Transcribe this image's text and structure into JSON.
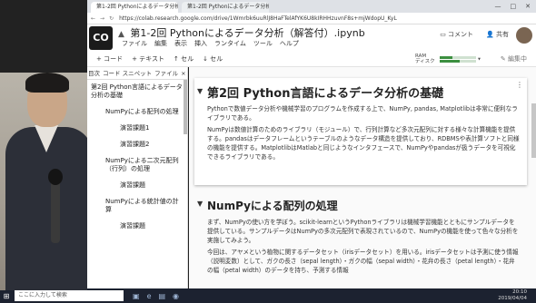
{
  "browser": {
    "tabs": [
      "第1-2回 Pythonによるデータ分析",
      "第1-2回 Pythonによるデータ分析"
    ],
    "url": "https://colab.research.google.com/drive/1Wmrbk6uuRlJ8HaFTelAfYK6U8kIRHHzuvnF8s+mjWdopU_KyL",
    "window_controls": [
      "—",
      "□",
      "✕"
    ]
  },
  "colab": {
    "logo": "CO",
    "title": "第1-2回 Pythonによるデータ分析（解答付）.ipynb",
    "menu": [
      "ファイル",
      "編集",
      "表示",
      "挿入",
      "ランタイム",
      "ツール",
      "ヘルプ"
    ],
    "comment_label": "コメント",
    "share_label": "共有"
  },
  "toolbar": {
    "code_label": "+ コード",
    "text_label": "+ テキスト",
    "cell_up": "↑ セル",
    "cell_down": "↓ セル",
    "ram_label": "RAM",
    "disk_label": "ディスク",
    "ram_fill": 0.35,
    "disk_fill": 0.55,
    "edit_label": "編集中"
  },
  "sidebar": {
    "tabs": [
      "目次",
      "コード スニペット",
      "ファイル"
    ],
    "close": "×",
    "toc": [
      {
        "level": 1,
        "label": "第2回 Python言語によるデータ分析の基礎"
      },
      {
        "level": 2,
        "label": "NumPyによる配列の処理"
      },
      {
        "level": 3,
        "label": "演習課題1"
      },
      {
        "level": 3,
        "label": "演習課題2"
      },
      {
        "level": 2,
        "label": "NumPyによる二次元配列（行列）の処理"
      },
      {
        "level": 3,
        "label": "演習課題"
      },
      {
        "level": 2,
        "label": "NumPyによる統計値の計算"
      },
      {
        "level": 3,
        "label": "演習課題"
      }
    ]
  },
  "content": {
    "section1": {
      "heading": "第2回 Python言語によるデータ分析の基礎",
      "paras": [
        "Pythonで数値データ分析や機械学習のプログラムを作成する上で、NumPy, pandas, Matplotlibは非常に便利なライブラリである。",
        "NumPyは数値計算のためのライブラリ（モジュール）で、行列計算など多次元配列に対する様々な計算機能を提供する。pandasはデータフレームというテーブルのようなデータ構造を提供しており、RDBMSや表計算ソフトと同様の機能を提供する。MatplotlibはMatlabと同じようなインタフェースで、NumPyやpandasが扱うデータを可視化できるライブラリである。"
      ]
    },
    "section2": {
      "heading": "NumPyによる配列の処理",
      "paras": [
        "まず、NumPyの使い方を学ぼう。scikit-learnというPythonライブラリは機械学習機能とともにサンプルデータを提供している。サンプルデータはNumPyの多次元配列で表現されているので、NumPyの機能を使って色々な分析を実施してみよう。",
        "今回は、アヤメという植物に関するデータセット（irisデータセット）を用いる。irisデータセットは予測に使う情報（説明変数）として、ガクの長さ（sepal length）・ガクの幅（sepal width）・花弁の長さ（petal length）・花弁の幅（petal width）のデータを持ち、予測する情報"
      ]
    }
  },
  "taskbar": {
    "search_placeholder": "ここに入力して検索",
    "time": "20:10",
    "date": "2019/04/04"
  }
}
